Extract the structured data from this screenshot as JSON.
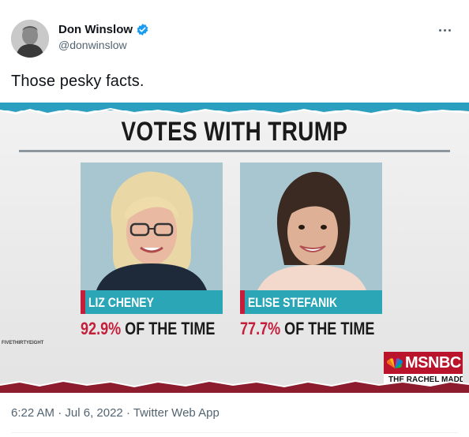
{
  "author": {
    "name": "Don Winslow",
    "handle": "@donwinslow",
    "verified": true,
    "verified_icon": "verified-badge-icon",
    "verified_color": "#1d9bf0"
  },
  "tweet": {
    "text": "Those pesky facts."
  },
  "media": {
    "headline": "VOTES WITH TRUMP",
    "cards": [
      {
        "name": "LIZ CHENEY",
        "percent": "92.9%",
        "suffix": " OF THE TIME"
      },
      {
        "name": "ELISE STEFANIK",
        "percent": "77.7%",
        "suffix": " OF THE TIME"
      }
    ],
    "source": "FIVETHIRTYEIGHT",
    "network": "MSNBC",
    "show": "THE RACHEL MADDOW SHOW",
    "accent_red": "#c41e3a",
    "accent_teal": "#2aa6b6"
  },
  "meta": {
    "time": "6:22 AM",
    "sep1": " · ",
    "date": "Jul 6, 2022",
    "sep2": " · ",
    "app": "Twitter Web App"
  }
}
